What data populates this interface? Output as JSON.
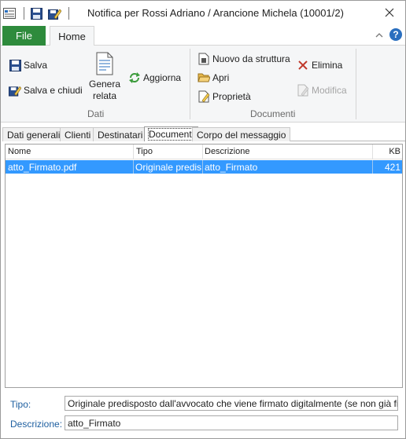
{
  "window": {
    "title": "Notifica per Rossi Adriano / Arancione Michela (10001/2)"
  },
  "qat": {
    "icons": [
      "form-icon",
      "save-icon",
      "save-edit-icon"
    ]
  },
  "ribbon": {
    "tabs": {
      "file": "File",
      "home": "Home"
    },
    "dati": {
      "salva": "Salva",
      "salva_chiudi": "Salva e chiudi",
      "genera_relata_line1": "Genera",
      "genera_relata_line2": "relata",
      "aggiorna": "Aggiorna",
      "group_label": "Dati"
    },
    "documenti": {
      "nuovo": "Nuovo da struttura",
      "apri": "Apri",
      "proprieta": "Proprietà",
      "elimina": "Elimina",
      "modifica": "Modifica",
      "group_label": "Documenti"
    }
  },
  "content_tabs": [
    "Dati generali",
    "Clienti",
    "Destinatari",
    "Documenti",
    "Corpo del messaggio"
  ],
  "grid": {
    "columns": {
      "nome": "Nome",
      "tipo": "Tipo",
      "descrizione": "Descrizione",
      "kb": "KB"
    },
    "rows": [
      {
        "nome": "atto_Firmato.pdf",
        "tipo": "Originale predisposto",
        "descrizione": "atto_Firmato",
        "kb": "421"
      }
    ]
  },
  "detail": {
    "tipo_label": "Tipo:",
    "tipo_value": "Originale predisposto dall'avvocato che viene firmato digitalmente (se non già firmato dal",
    "descrizione_label": "Descrizione:",
    "descrizione_value": "atto_Firmato"
  },
  "colors": {
    "file_tab": "#2e8b3c",
    "selection": "#3399ff",
    "field_label": "#1e5fa0",
    "ribbon_bg": "#f5f6f7"
  }
}
